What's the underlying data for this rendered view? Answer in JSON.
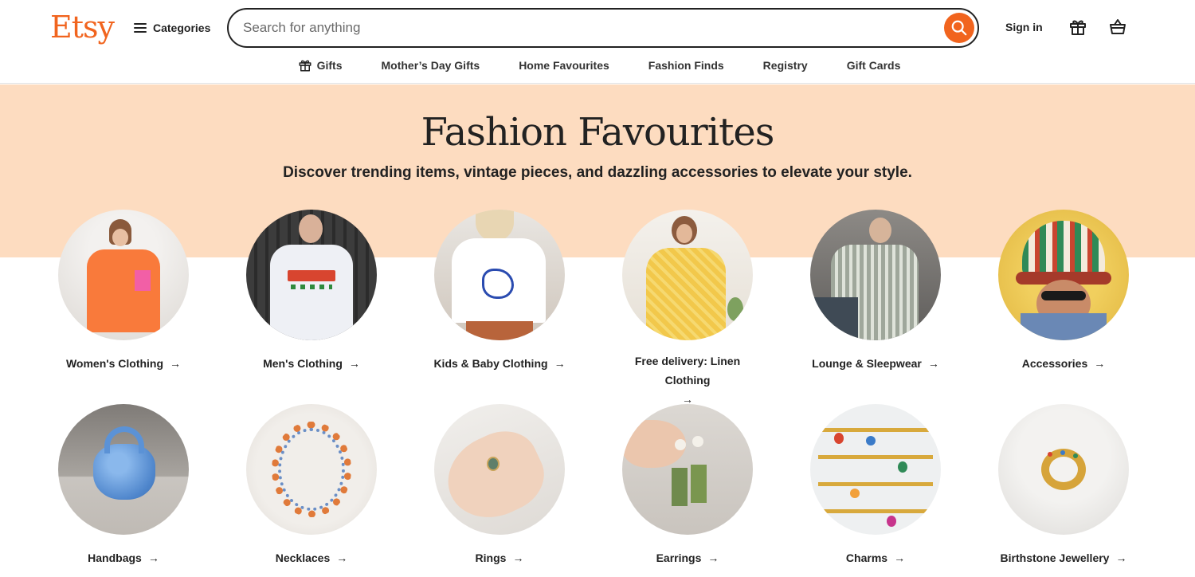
{
  "header": {
    "logo": "Etsy",
    "categories_label": "Categories",
    "search_placeholder": "Search for anything",
    "signin_label": "Sign in"
  },
  "subnav": [
    {
      "label": "Gifts",
      "icon": "gift-icon"
    },
    {
      "label": "Mother’s Day Gifts"
    },
    {
      "label": "Home Favourites"
    },
    {
      "label": "Fashion Finds"
    },
    {
      "label": "Registry"
    },
    {
      "label": "Gift Cards"
    }
  ],
  "hero": {
    "title": "Fashion Favourites",
    "subtitle": "Discover trending items, vintage pieces, and dazzling accessories to elevate your style."
  },
  "tiles": [
    {
      "label": "Women's Clothing"
    },
    {
      "label": "Men's Clothing"
    },
    {
      "label": "Kids & Baby Clothing"
    },
    {
      "label": "Free delivery: Linen Clothing"
    },
    {
      "label": "Lounge & Sleepwear"
    },
    {
      "label": "Accessories"
    },
    {
      "label": "Handbags"
    },
    {
      "label": "Necklaces"
    },
    {
      "label": "Rings"
    },
    {
      "label": "Earrings"
    },
    {
      "label": "Charms"
    },
    {
      "label": "Birthstone Jewellery"
    }
  ],
  "colors": {
    "brand": "#f1641e",
    "hero_band": "#fddcc0",
    "text": "#222222"
  },
  "icons": {
    "arrow": "→",
    "search": "search-icon",
    "gift": "gift-icon",
    "cart": "shopping-bag-icon",
    "menu": "menu-icon"
  }
}
